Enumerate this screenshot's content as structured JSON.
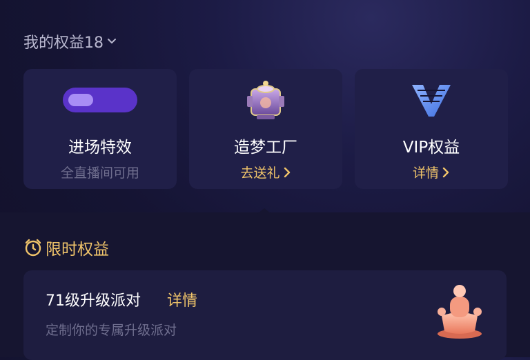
{
  "header": {
    "title": "我的权益18"
  },
  "cards": [
    {
      "title": "进场特效",
      "subtitle": "全直播间可用"
    },
    {
      "title": "造梦工厂",
      "subtitle": "去送礼"
    },
    {
      "title": "VIP权益",
      "subtitle": "详情"
    }
  ],
  "limited": {
    "title": "限时权益"
  },
  "party": {
    "title": "71级升级派对",
    "detail": "详情",
    "subtitle": "定制你的专属升级派对"
  },
  "colors": {
    "gold": "#f0c46a",
    "purple": "#5a33c9",
    "card_bg": "#201f48"
  },
  "icons": {
    "header": "chevron-down-icon",
    "card1": "toggle-effect-icon",
    "card2": "dream-factory-icon",
    "card3": "vip-v-logo",
    "limited": "alarm-clock-icon",
    "party": "trophy-icon"
  }
}
